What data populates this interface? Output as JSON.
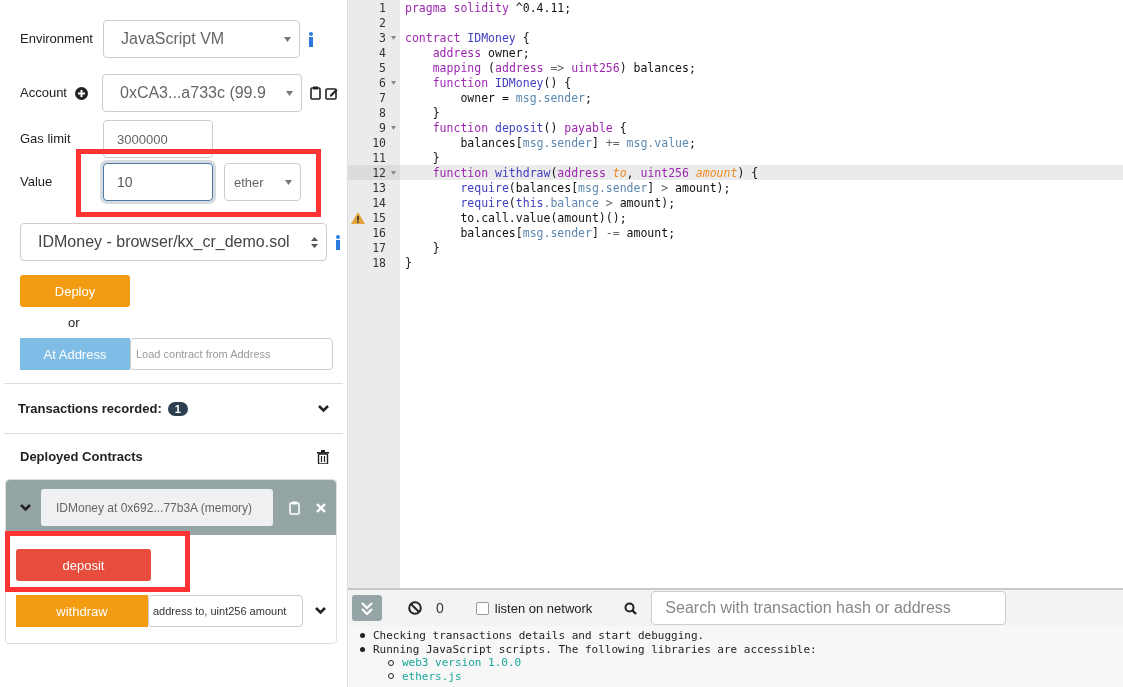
{
  "run_panel": {
    "environment": {
      "label": "Environment",
      "value": "JavaScript VM"
    },
    "account": {
      "label": "Account",
      "value": "0xCA3...a733c (99.9"
    },
    "gas_limit": {
      "label": "Gas limit",
      "value": "3000000"
    },
    "value": {
      "label": "Value",
      "value": "10",
      "unit": "ether",
      "focused": true,
      "highlighted": true
    },
    "contract": {
      "value": "IDMoney - browser/kx_cr_demo.sol"
    },
    "deploy": {
      "label": "Deploy"
    },
    "or": "or",
    "at_address": {
      "label": "At Address",
      "placeholder": "Load contract from Address"
    },
    "transactions": {
      "label": "Transactions recorded:",
      "count": "1",
      "expanded": false
    },
    "deployed": {
      "title": "Deployed Contracts",
      "instances": [
        {
          "name": "IDMoney at 0x692...77b3A (memory)",
          "expanded": true,
          "functions": [
            {
              "kind": "payable",
              "label": "deposit",
              "highlighted": true
            },
            {
              "kind": "call",
              "label": "withdraw",
              "placeholder": "address to, uint256 amount"
            }
          ]
        }
      ]
    }
  },
  "editor": {
    "lines": [
      {
        "number": "1",
        "tokens": [
          {
            "kind": "kw",
            "text": "pragma solidity"
          },
          {
            "kind": "plain",
            "text": " ^0.4.11;"
          }
        ]
      },
      {
        "number": "2"
      },
      {
        "number": "3",
        "fold": true,
        "tokens": [
          {
            "kind": "kw",
            "text": "contract"
          },
          {
            "kind": "name",
            "text": " IDMoney"
          },
          {
            "kind": "plain",
            "text": " {"
          }
        ]
      },
      {
        "number": "4",
        "tokens": [
          {
            "kind": "kw",
            "text": "    address"
          },
          {
            "kind": "plain",
            "text": " owner;"
          }
        ]
      },
      {
        "number": "5",
        "tokens": [
          {
            "kind": "kw",
            "text": "    mapping"
          },
          {
            "kind": "plain",
            "text": " ("
          },
          {
            "kind": "kw",
            "text": "address"
          },
          {
            "kind": "op",
            "text": " => "
          },
          {
            "kind": "kw",
            "text": "uint256"
          },
          {
            "kind": "plain",
            "text": ") balances;"
          }
        ]
      },
      {
        "number": "6",
        "fold": true,
        "tokens": [
          {
            "kind": "kw",
            "text": "    function"
          },
          {
            "kind": "name",
            "text": " IDMoney"
          },
          {
            "kind": "plain",
            "text": "() {"
          }
        ]
      },
      {
        "number": "7",
        "tokens": [
          {
            "kind": "plain",
            "text": "        owner = "
          },
          {
            "kind": "member",
            "text": "msg.sender"
          },
          {
            "kind": "plain",
            "text": ";"
          }
        ]
      },
      {
        "number": "8",
        "tokens": [
          {
            "kind": "plain",
            "text": "    }"
          }
        ]
      },
      {
        "number": "9",
        "fold": true,
        "tokens": [
          {
            "kind": "kw",
            "text": "    function"
          },
          {
            "kind": "name",
            "text": " deposit"
          },
          {
            "kind": "plain",
            "text": "() "
          },
          {
            "kind": "kw",
            "text": "payable"
          },
          {
            "kind": "plain",
            "text": " {"
          }
        ]
      },
      {
        "number": "10",
        "tokens": [
          {
            "kind": "plain",
            "text": "        balances["
          },
          {
            "kind": "member",
            "text": "msg.sender"
          },
          {
            "kind": "plain",
            "text": "] "
          },
          {
            "kind": "op",
            "text": "+="
          },
          {
            "kind": "member",
            "text": " msg.value"
          },
          {
            "kind": "plain",
            "text": ";"
          }
        ]
      },
      {
        "number": "11",
        "tokens": [
          {
            "kind": "plain",
            "text": "    }"
          }
        ]
      },
      {
        "number": "12",
        "fold": true,
        "active": true,
        "tokens": [
          {
            "kind": "kw",
            "text": "    function"
          },
          {
            "kind": "name",
            "text": " withdraw"
          },
          {
            "kind": "plain",
            "text": "("
          },
          {
            "kind": "kw",
            "text": "address"
          },
          {
            "kind": "param",
            "text": " to"
          },
          {
            "kind": "plain",
            "text": ", "
          },
          {
            "kind": "kw",
            "text": "uint256"
          },
          {
            "kind": "param",
            "text": " amount"
          },
          {
            "kind": "plain",
            "text": ") {"
          }
        ]
      },
      {
        "number": "13",
        "tokens": [
          {
            "kind": "name",
            "text": "        require"
          },
          {
            "kind": "plain",
            "text": "(balances["
          },
          {
            "kind": "member",
            "text": "msg.sender"
          },
          {
            "kind": "plain",
            "text": "] "
          },
          {
            "kind": "op",
            "text": ">"
          },
          {
            "kind": "plain",
            "text": " amount);"
          }
        ]
      },
      {
        "number": "14",
        "tokens": [
          {
            "kind": "name",
            "text": "        require"
          },
          {
            "kind": "plain",
            "text": "("
          },
          {
            "kind": "name",
            "text": "this"
          },
          {
            "kind": "member",
            "text": ".balance"
          },
          {
            "kind": "op",
            "text": " > "
          },
          {
            "kind": "plain",
            "text": "amount);"
          }
        ]
      },
      {
        "number": "15",
        "warning": true,
        "tokens": [
          {
            "kind": "plain",
            "text": "        to.call.value(amount)();"
          }
        ]
      },
      {
        "number": "16",
        "tokens": [
          {
            "kind": "plain",
            "text": "        balances["
          },
          {
            "kind": "member",
            "text": "msg.sender"
          },
          {
            "kind": "plain",
            "text": "] "
          },
          {
            "kind": "op",
            "text": "-="
          },
          {
            "kind": "plain",
            "text": " amount;"
          }
        ]
      },
      {
        "number": "17",
        "tokens": [
          {
            "kind": "plain",
            "text": "    }"
          }
        ]
      },
      {
        "number": "18",
        "tokens": [
          {
            "kind": "plain",
            "text": "}"
          }
        ]
      }
    ]
  },
  "terminal": {
    "pending_count": "0",
    "listen_on_network": {
      "label": "listen on network",
      "checked": false
    },
    "search": {
      "placeholder": "Search with transaction hash or address"
    },
    "output": [
      {
        "kind": "bullet",
        "text": "Checking transactions details and start debugging."
      },
      {
        "kind": "bullet",
        "text": "Running JavaScript scripts. The following libraries are accessible:"
      },
      {
        "kind": "sub",
        "text": "web3 version 1.0.0"
      },
      {
        "kind": "sub",
        "text": "ethers.js"
      }
    ]
  }
}
